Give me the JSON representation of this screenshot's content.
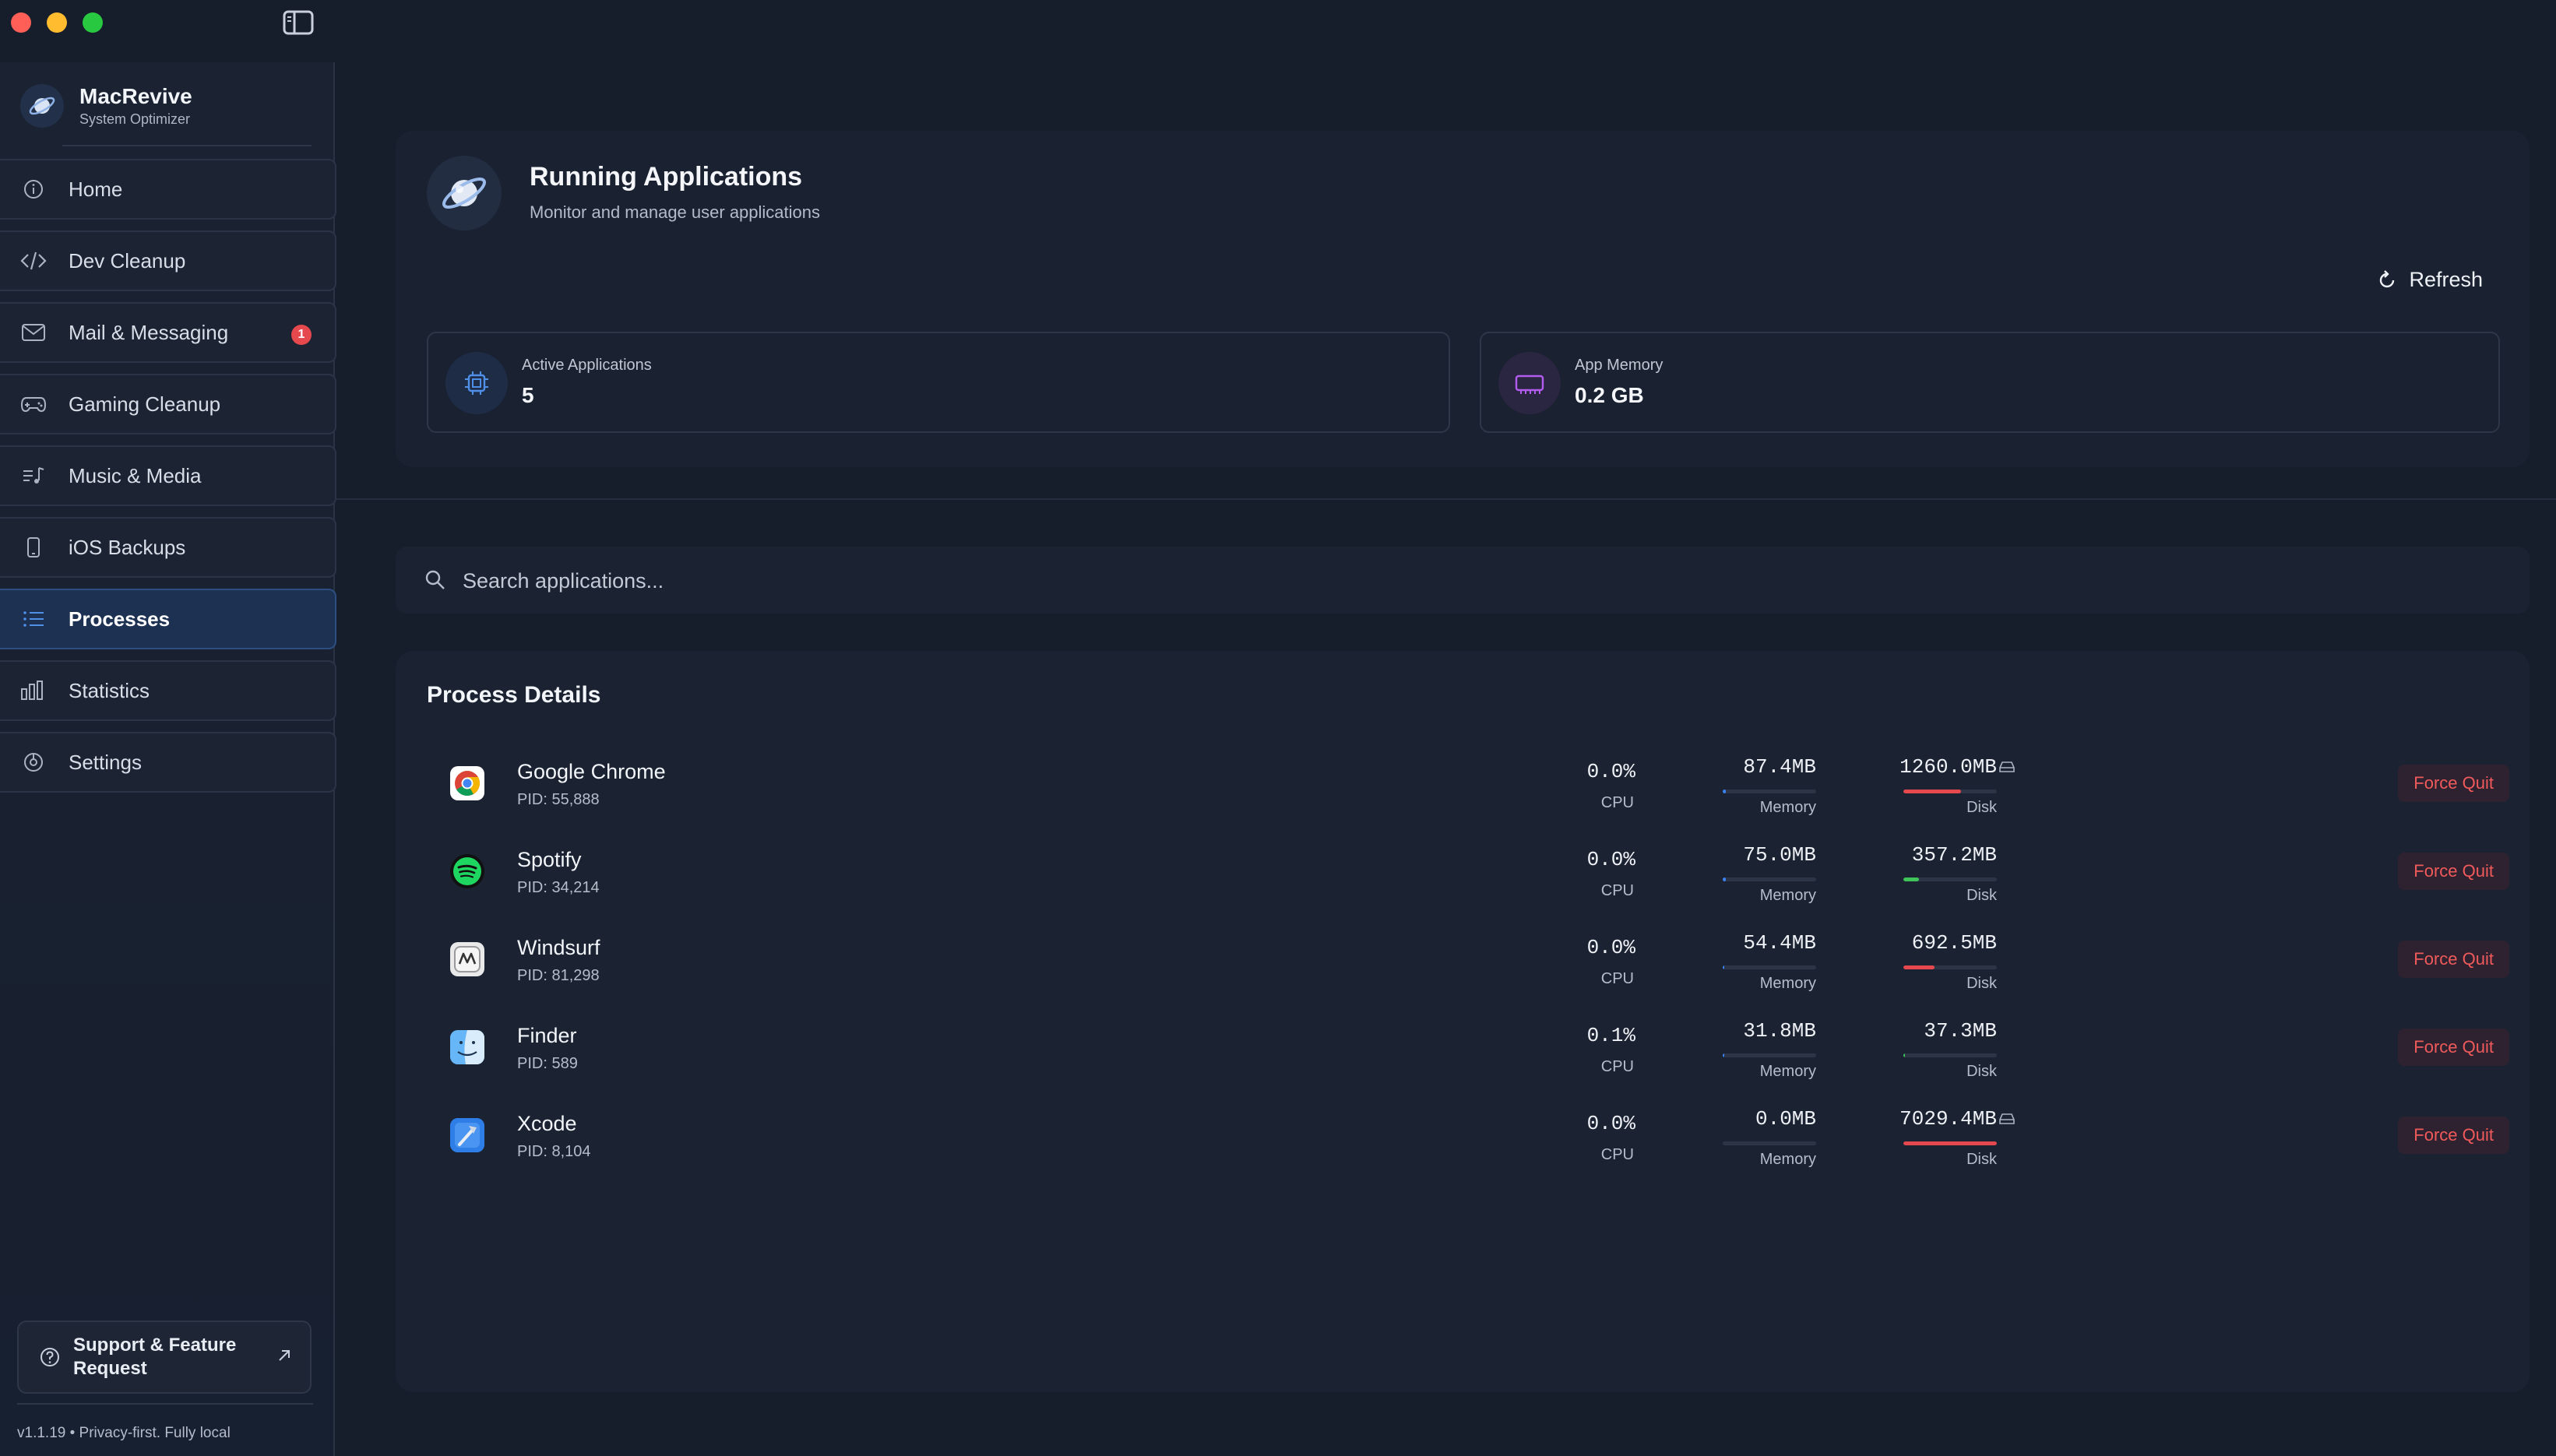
{
  "app": {
    "name": "MacRevive",
    "subtitle": "System Optimizer",
    "version_text": "v1.1.19  •  Privacy-first. Fully local"
  },
  "sidebar": {
    "items": [
      {
        "label": "Home",
        "icon": "info-icon",
        "active": false
      },
      {
        "label": "Dev Cleanup",
        "icon": "code-icon",
        "active": false
      },
      {
        "label": "Mail & Messaging",
        "icon": "mail-icon",
        "active": false,
        "badge": "1"
      },
      {
        "label": "Gaming Cleanup",
        "icon": "gamepad-icon",
        "active": false
      },
      {
        "label": "Music & Media",
        "icon": "music-list-icon",
        "active": false
      },
      {
        "label": "iOS Backups",
        "icon": "phone-icon",
        "active": false
      },
      {
        "label": "Processes",
        "icon": "list-icon",
        "active": true
      },
      {
        "label": "Statistics",
        "icon": "bar-chart-icon",
        "active": false
      },
      {
        "label": "Settings",
        "icon": "settings-icon",
        "active": false
      }
    ],
    "support_label": "Support & Feature Request"
  },
  "header": {
    "title": "Running Applications",
    "subtitle": "Monitor and manage user applications",
    "refresh_label": "Refresh"
  },
  "stats": {
    "active_label": "Active Applications",
    "active_value": "5",
    "memory_label": "App Memory",
    "memory_value": "0.2 GB"
  },
  "search": {
    "placeholder": "Search applications..."
  },
  "process_details": {
    "title": "Process Details",
    "cpu_label": "CPU",
    "memory_label": "Memory",
    "disk_label": "Disk",
    "force_quit_label": "Force Quit",
    "rows": [
      {
        "name": "Google Chrome",
        "pid": "PID: 55,888",
        "cpu": "0.0%",
        "memory": "87.4MB",
        "memory_fraction": 0.03,
        "disk": "1260.0MB",
        "disk_fraction": 0.62,
        "disk_color": "#e5484d",
        "disk_warning": true
      },
      {
        "name": "Spotify",
        "pid": "PID: 34,214",
        "cpu": "0.0%",
        "memory": "75.0MB",
        "memory_fraction": 0.03,
        "disk": "357.2MB",
        "disk_fraction": 0.17,
        "disk_color": "#3fc45a",
        "disk_warning": false
      },
      {
        "name": "Windsurf",
        "pid": "PID: 81,298",
        "cpu": "0.0%",
        "memory": "54.4MB",
        "memory_fraction": 0.02,
        "disk": "692.5MB",
        "disk_fraction": 0.33,
        "disk_color": "#e5484d",
        "disk_warning": false
      },
      {
        "name": "Finder",
        "pid": "PID: 589",
        "cpu": "0.1%",
        "memory": "31.8MB",
        "memory_fraction": 0.01,
        "disk": "37.3MB",
        "disk_fraction": 0.02,
        "disk_color": "#3fc45a",
        "disk_warning": false
      },
      {
        "name": "Xcode",
        "pid": "PID: 8,104",
        "cpu": "0.0%",
        "memory": "0.0MB",
        "memory_fraction": 0.0,
        "disk": "7029.4MB",
        "disk_fraction": 1.0,
        "disk_color": "#e5484d",
        "disk_warning": true
      }
    ]
  },
  "colors": {
    "accent": "#3b82f6",
    "danger": "#e5484d",
    "success": "#3fc45a"
  }
}
